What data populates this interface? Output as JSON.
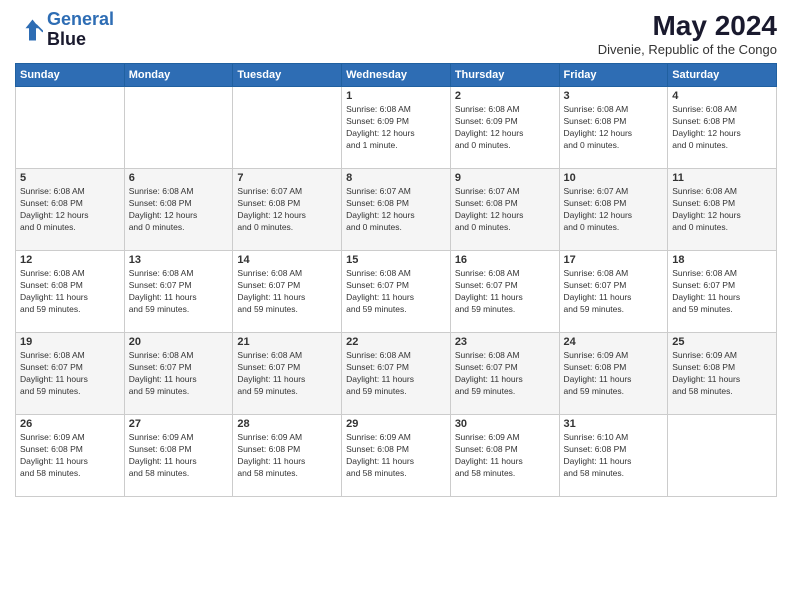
{
  "logo": {
    "line1": "General",
    "line2": "Blue"
  },
  "title": "May 2024",
  "subtitle": "Divenie, Republic of the Congo",
  "days_of_week": [
    "Sunday",
    "Monday",
    "Tuesday",
    "Wednesday",
    "Thursday",
    "Friday",
    "Saturday"
  ],
  "weeks": [
    [
      {
        "day": "",
        "info": ""
      },
      {
        "day": "",
        "info": ""
      },
      {
        "day": "",
        "info": ""
      },
      {
        "day": "1",
        "info": "Sunrise: 6:08 AM\nSunset: 6:09 PM\nDaylight: 12 hours\nand 1 minute."
      },
      {
        "day": "2",
        "info": "Sunrise: 6:08 AM\nSunset: 6:09 PM\nDaylight: 12 hours\nand 0 minutes."
      },
      {
        "day": "3",
        "info": "Sunrise: 6:08 AM\nSunset: 6:08 PM\nDaylight: 12 hours\nand 0 minutes."
      },
      {
        "day": "4",
        "info": "Sunrise: 6:08 AM\nSunset: 6:08 PM\nDaylight: 12 hours\nand 0 minutes."
      }
    ],
    [
      {
        "day": "5",
        "info": "Sunrise: 6:08 AM\nSunset: 6:08 PM\nDaylight: 12 hours\nand 0 minutes."
      },
      {
        "day": "6",
        "info": "Sunrise: 6:08 AM\nSunset: 6:08 PM\nDaylight: 12 hours\nand 0 minutes."
      },
      {
        "day": "7",
        "info": "Sunrise: 6:07 AM\nSunset: 6:08 PM\nDaylight: 12 hours\nand 0 minutes."
      },
      {
        "day": "8",
        "info": "Sunrise: 6:07 AM\nSunset: 6:08 PM\nDaylight: 12 hours\nand 0 minutes."
      },
      {
        "day": "9",
        "info": "Sunrise: 6:07 AM\nSunset: 6:08 PM\nDaylight: 12 hours\nand 0 minutes."
      },
      {
        "day": "10",
        "info": "Sunrise: 6:07 AM\nSunset: 6:08 PM\nDaylight: 12 hours\nand 0 minutes."
      },
      {
        "day": "11",
        "info": "Sunrise: 6:08 AM\nSunset: 6:08 PM\nDaylight: 12 hours\nand 0 minutes."
      }
    ],
    [
      {
        "day": "12",
        "info": "Sunrise: 6:08 AM\nSunset: 6:08 PM\nDaylight: 11 hours\nand 59 minutes."
      },
      {
        "day": "13",
        "info": "Sunrise: 6:08 AM\nSunset: 6:07 PM\nDaylight: 11 hours\nand 59 minutes."
      },
      {
        "day": "14",
        "info": "Sunrise: 6:08 AM\nSunset: 6:07 PM\nDaylight: 11 hours\nand 59 minutes."
      },
      {
        "day": "15",
        "info": "Sunrise: 6:08 AM\nSunset: 6:07 PM\nDaylight: 11 hours\nand 59 minutes."
      },
      {
        "day": "16",
        "info": "Sunrise: 6:08 AM\nSunset: 6:07 PM\nDaylight: 11 hours\nand 59 minutes."
      },
      {
        "day": "17",
        "info": "Sunrise: 6:08 AM\nSunset: 6:07 PM\nDaylight: 11 hours\nand 59 minutes."
      },
      {
        "day": "18",
        "info": "Sunrise: 6:08 AM\nSunset: 6:07 PM\nDaylight: 11 hours\nand 59 minutes."
      }
    ],
    [
      {
        "day": "19",
        "info": "Sunrise: 6:08 AM\nSunset: 6:07 PM\nDaylight: 11 hours\nand 59 minutes."
      },
      {
        "day": "20",
        "info": "Sunrise: 6:08 AM\nSunset: 6:07 PM\nDaylight: 11 hours\nand 59 minutes."
      },
      {
        "day": "21",
        "info": "Sunrise: 6:08 AM\nSunset: 6:07 PM\nDaylight: 11 hours\nand 59 minutes."
      },
      {
        "day": "22",
        "info": "Sunrise: 6:08 AM\nSunset: 6:07 PM\nDaylight: 11 hours\nand 59 minutes."
      },
      {
        "day": "23",
        "info": "Sunrise: 6:08 AM\nSunset: 6:07 PM\nDaylight: 11 hours\nand 59 minutes."
      },
      {
        "day": "24",
        "info": "Sunrise: 6:09 AM\nSunset: 6:08 PM\nDaylight: 11 hours\nand 59 minutes."
      },
      {
        "day": "25",
        "info": "Sunrise: 6:09 AM\nSunset: 6:08 PM\nDaylight: 11 hours\nand 58 minutes."
      }
    ],
    [
      {
        "day": "26",
        "info": "Sunrise: 6:09 AM\nSunset: 6:08 PM\nDaylight: 11 hours\nand 58 minutes."
      },
      {
        "day": "27",
        "info": "Sunrise: 6:09 AM\nSunset: 6:08 PM\nDaylight: 11 hours\nand 58 minutes."
      },
      {
        "day": "28",
        "info": "Sunrise: 6:09 AM\nSunset: 6:08 PM\nDaylight: 11 hours\nand 58 minutes."
      },
      {
        "day": "29",
        "info": "Sunrise: 6:09 AM\nSunset: 6:08 PM\nDaylight: 11 hours\nand 58 minutes."
      },
      {
        "day": "30",
        "info": "Sunrise: 6:09 AM\nSunset: 6:08 PM\nDaylight: 11 hours\nand 58 minutes."
      },
      {
        "day": "31",
        "info": "Sunrise: 6:10 AM\nSunset: 6:08 PM\nDaylight: 11 hours\nand 58 minutes."
      },
      {
        "day": "",
        "info": ""
      }
    ]
  ],
  "colors": {
    "header_bg": "#2e6db4",
    "logo_blue": "#3a7bd5",
    "text_dark": "#1a1a2e"
  }
}
